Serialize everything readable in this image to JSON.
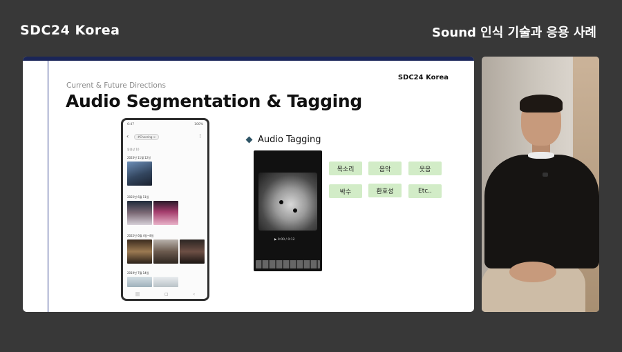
{
  "header": {
    "brand": "SDC24 Korea",
    "session_title": "Sound 인식 기술과 응용 사례"
  },
  "slide": {
    "logo": "SDC24 Korea",
    "kicker": "Current & Future Directions",
    "heading": "Audio Segmentation & Tagging",
    "phone": {
      "time": "6:47",
      "battery": "100%",
      "search_chip": "#Cheering ×",
      "subheading": "동영상 10",
      "dates": [
        "2023년 11월 12일",
        "2022년 6월 11일",
        "2022년 6월 4일~8일",
        "2019년 7월 14일"
      ]
    },
    "audio_tagging": {
      "title": "Audio Tagging",
      "video_timestamp": "▶ 0:00 / 0:12",
      "tags": [
        "목소리",
        "음악",
        "웃음",
        "박수",
        "환호성",
        "Etc.."
      ]
    }
  },
  "colors": {
    "background": "#383838",
    "slide_accent": "#1a2558",
    "tag_chip": "#d2ecc7",
    "bullet_diamond": "#2e5466"
  },
  "icons": [
    "back-arrow-icon",
    "more-vert-icon",
    "diamond-bullet-icon",
    "play-icon"
  ]
}
